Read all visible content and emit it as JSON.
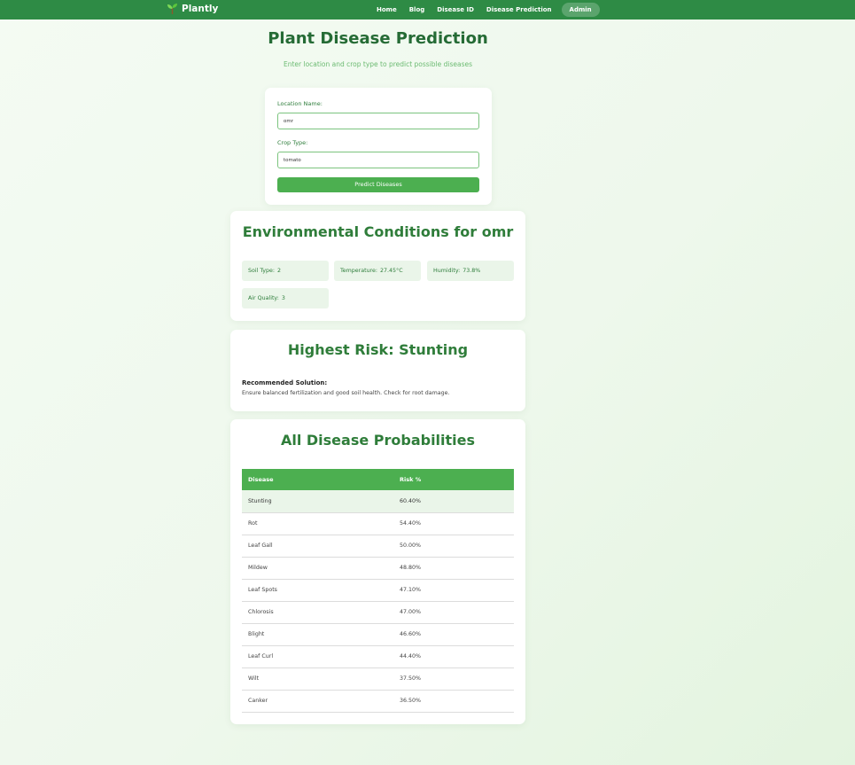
{
  "nav": {
    "brand": "Plantly",
    "links": [
      "Home",
      "Blog",
      "Disease ID",
      "Disease Prediction",
      "Admin"
    ]
  },
  "page": {
    "title": "Plant Disease Prediction",
    "subtitle": "Enter location and crop type to predict possible diseases"
  },
  "form": {
    "location_label": "Location Name:",
    "location_value": "omr",
    "crop_label": "Crop Type:",
    "crop_value": "tomato",
    "submit_label": "Predict Diseases"
  },
  "environment": {
    "heading": "Environmental Conditions for omr",
    "conditions": [
      {
        "label": "Soil Type:",
        "value": "2"
      },
      {
        "label": "Temperature:",
        "value": "27.45°C"
      },
      {
        "label": "Humidity:",
        "value": "73.8%"
      },
      {
        "label": "Air Quality:",
        "value": "3"
      }
    ]
  },
  "risk": {
    "heading": "Highest Risk: Stunting",
    "solution_label": "Recommended Solution:",
    "solution_text": "Ensure balanced fertilization and good soil health. Check for root damage."
  },
  "probabilities": {
    "heading": "All Disease Probabilities",
    "columns": [
      "Disease",
      "Risk %"
    ],
    "rows": [
      {
        "disease": "Stunting",
        "risk": "60.40%"
      },
      {
        "disease": "Rot",
        "risk": "54.40%"
      },
      {
        "disease": "Leaf Gall",
        "risk": "50.00%"
      },
      {
        "disease": "Mildew",
        "risk": "48.80%"
      },
      {
        "disease": "Leaf Spots",
        "risk": "47.10%"
      },
      {
        "disease": "Chlorosis",
        "risk": "47.00%"
      },
      {
        "disease": "Blight",
        "risk": "46.60%"
      },
      {
        "disease": "Leaf Curl",
        "risk": "44.40%"
      },
      {
        "disease": "Wilt",
        "risk": "37.50%"
      },
      {
        "disease": "Canker",
        "risk": "36.50%"
      }
    ]
  },
  "colors": {
    "nav": "#2e8b45",
    "accent": "#4caf50",
    "heading": "#2f7d3a"
  }
}
